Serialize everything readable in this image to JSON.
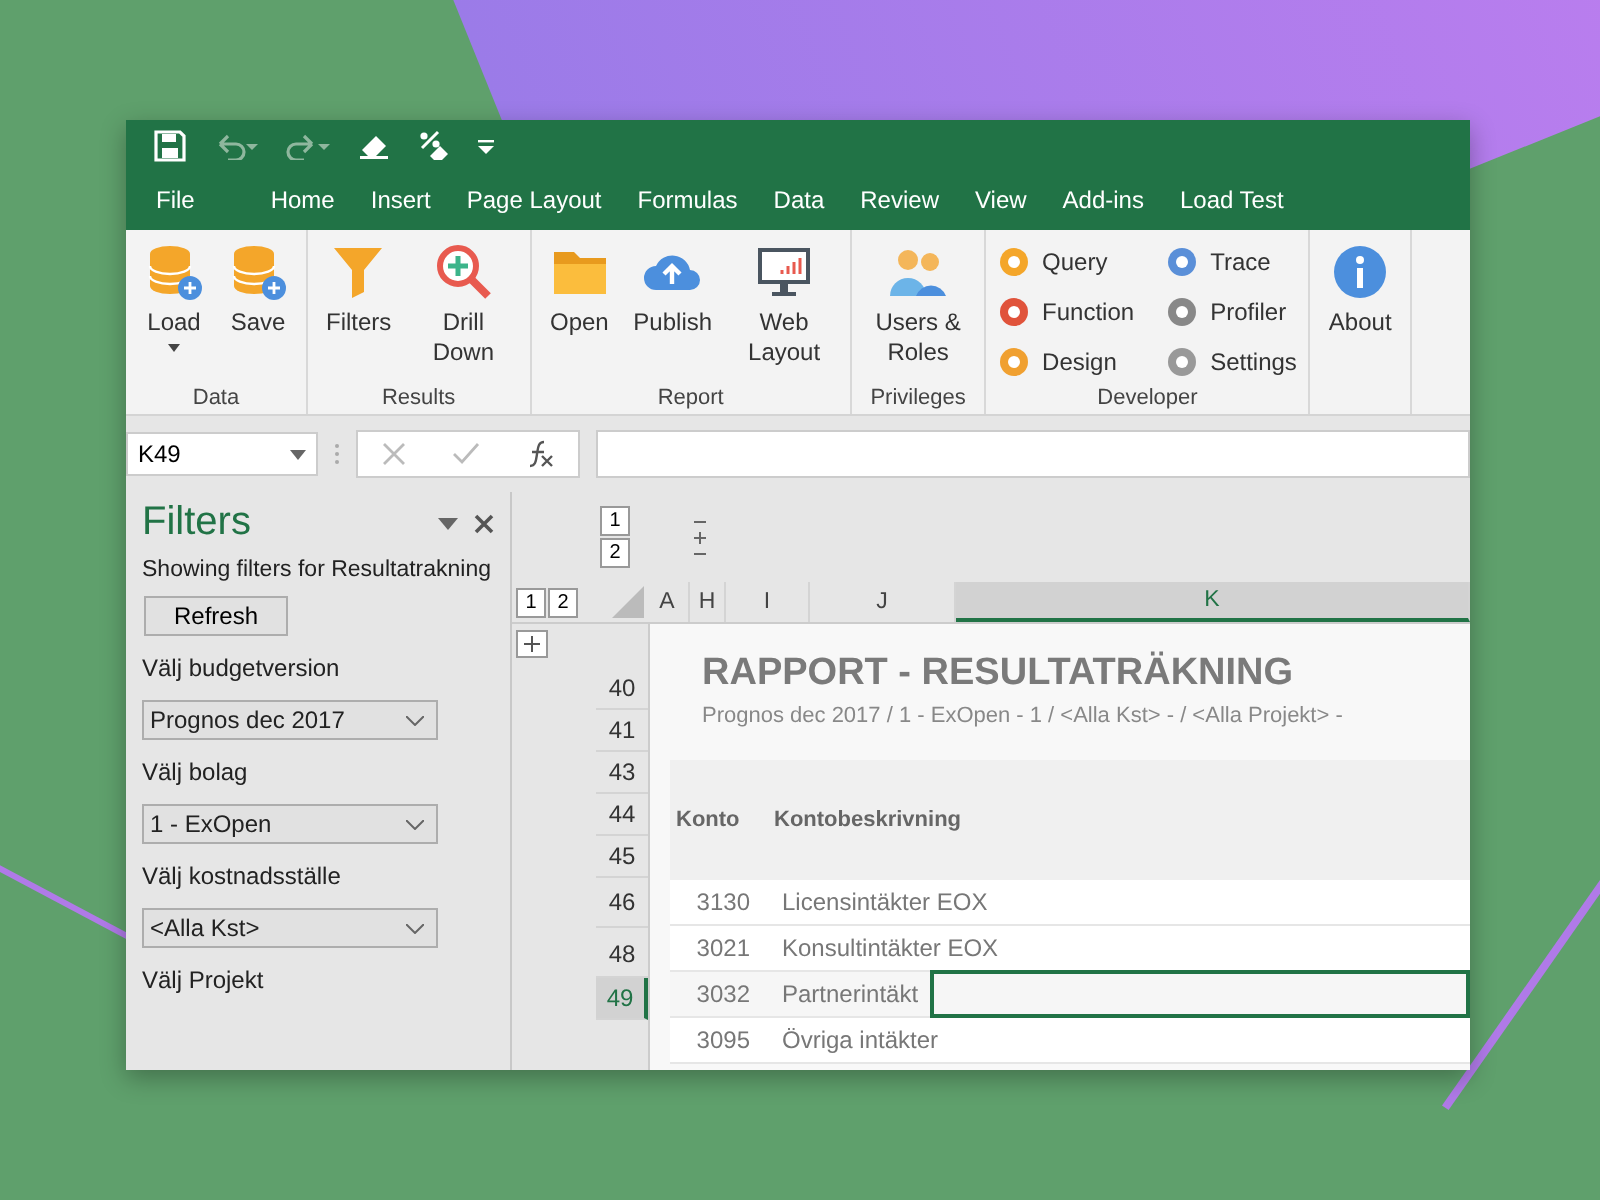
{
  "tabs": [
    {
      "label": "File",
      "kind": "file"
    },
    {
      "label": "Home",
      "kind": "tab"
    },
    {
      "label": "Insert",
      "kind": "tab"
    },
    {
      "label": "Page Layout",
      "kind": "tab"
    },
    {
      "label": "Formulas",
      "kind": "tab"
    },
    {
      "label": "Data",
      "kind": "tab"
    },
    {
      "label": "Review",
      "kind": "tab"
    },
    {
      "label": "View",
      "kind": "tab"
    },
    {
      "label": "Add-ins",
      "kind": "tab"
    },
    {
      "label": "Load Test",
      "kind": "tab"
    }
  ],
  "ribbon_groups": [
    {
      "label": "Data",
      "kind": "large",
      "buttons": [
        {
          "label": "Load",
          "dropdown": true
        },
        {
          "label": "Save",
          "dropdown": false
        }
      ]
    },
    {
      "label": "Results",
      "kind": "large",
      "buttons": [
        {
          "label": "Filters",
          "dropdown": false
        },
        {
          "label": "Drill Down",
          "dropdown": false
        }
      ]
    },
    {
      "label": "Report",
      "kind": "large",
      "buttons": [
        {
          "label": "Open",
          "dropdown": false
        },
        {
          "label": "Publish",
          "dropdown": false
        },
        {
          "label": "Web Layout",
          "dropdown": false
        }
      ]
    },
    {
      "label": "Privileges",
      "kind": "large",
      "buttons": [
        {
          "label": "Users & Roles",
          "dropdown": false
        }
      ]
    },
    {
      "label": "Developer",
      "kind": "small",
      "buttons": [
        {
          "label": "Query",
          "dropdown": false
        },
        {
          "label": "Function",
          "dropdown": false
        },
        {
          "label": "Design",
          "dropdown": false
        },
        {
          "label": "Trace",
          "dropdown": false
        },
        {
          "label": "Profiler",
          "dropdown": false
        },
        {
          "label": "Settings",
          "dropdown": false
        }
      ]
    },
    {
      "kind": "large",
      "buttons": [
        {
          "label": "About",
          "dropdown": false
        }
      ]
    }
  ],
  "name_box": "K49",
  "filters_pane": {
    "title": "Filters",
    "subtitle": "Showing filters for Resultatrakning",
    "refresh": "Refresh",
    "fields": [
      {
        "label": "Välj budgetversion",
        "value": "Prognos dec 2017"
      },
      {
        "label": "Välj bolag",
        "value": "1 - ExOpen"
      },
      {
        "label": "Välj kostnadsställe",
        "value": "<Alla Kst>"
      },
      {
        "label": "Välj Projekt"
      }
    ]
  },
  "row_outline_levels": [
    "1",
    "2"
  ],
  "column_outline_levels": [
    "1",
    "2"
  ],
  "column_headers": [
    {
      "label": "A",
      "selected": false
    },
    {
      "label": "H",
      "selected": false
    },
    {
      "label": "I",
      "selected": false
    },
    {
      "label": "J",
      "selected": false
    },
    {
      "label": "K",
      "selected": true
    }
  ],
  "row_headers": [
    {
      "label": "40",
      "selected": false
    },
    {
      "label": "41",
      "selected": false
    },
    {
      "label": "43",
      "selected": false
    },
    {
      "label": "44",
      "selected": false
    },
    {
      "label": "45",
      "selected": false
    },
    {
      "label": "46",
      "selected": false
    },
    {
      "label": "48",
      "selected": false
    },
    {
      "label": "49",
      "selected": true
    }
  ],
  "report": {
    "title": "RAPPORT - RESULTATRÄKNING",
    "subtitle": "Prognos dec 2017 / 1 - ExOpen - 1 / <Alla Kst> -  / <Alla Projekt> -",
    "columns": [
      "Konto",
      "Kontobeskrivning"
    ],
    "rows": [
      {
        "konto": "3130",
        "description": "Licensintäkter EOX",
        "selected": false
      },
      {
        "konto": "3021",
        "description": "Konsultintäkter EOX",
        "selected": false
      },
      {
        "konto": "3032",
        "description": "Partnerintäkt",
        "selected": true
      },
      {
        "konto": "3095",
        "description": "Övriga intäkter",
        "selected": false
      }
    ]
  }
}
